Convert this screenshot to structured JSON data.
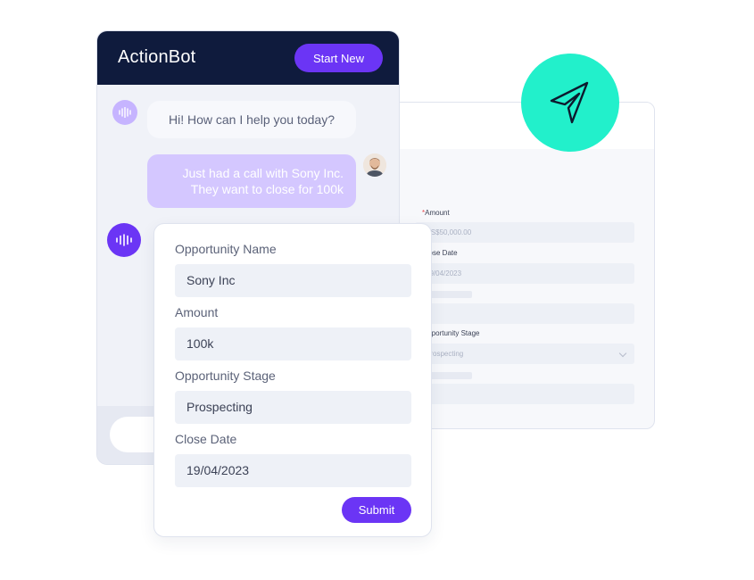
{
  "chat": {
    "brand": "ActionBot",
    "start_new_label": "Start New",
    "bot_message": "Hi! How can I help you today?",
    "user_message_line1": "Just had a call with Sony Inc.",
    "user_message_line2": "They want to close for 100k"
  },
  "form": {
    "opportunity_name_label": "Opportunity Name",
    "opportunity_name_value": "Sony Inc",
    "amount_label": "Amount",
    "amount_value": "100k",
    "stage_label": "Opportunity Stage",
    "stage_value": "Prospecting",
    "close_date_label": "Close Date",
    "close_date_value": "19/04/2023",
    "submit_label": "Submit"
  },
  "crm": {
    "amount_required_mark": "*",
    "amount_label": "Amount",
    "amount_value": "US$50,000.00",
    "close_date_label": "Close Date",
    "close_date_value": "19/04/2023",
    "stage_label": "Opportunity Stage",
    "stage_value": "Prospecting"
  },
  "icons": {
    "send": "paper-plane-icon",
    "bot": "voice-wave-icon",
    "user": "user-avatar-icon",
    "dropdown": "chevron-down-icon"
  },
  "colors": {
    "accent": "#6b35f5",
    "header": "#0f1b3d",
    "teal": "#22f0cb",
    "user_bubble": "#d4c7ff",
    "bot_avatar_light": "#c6b4ff"
  }
}
